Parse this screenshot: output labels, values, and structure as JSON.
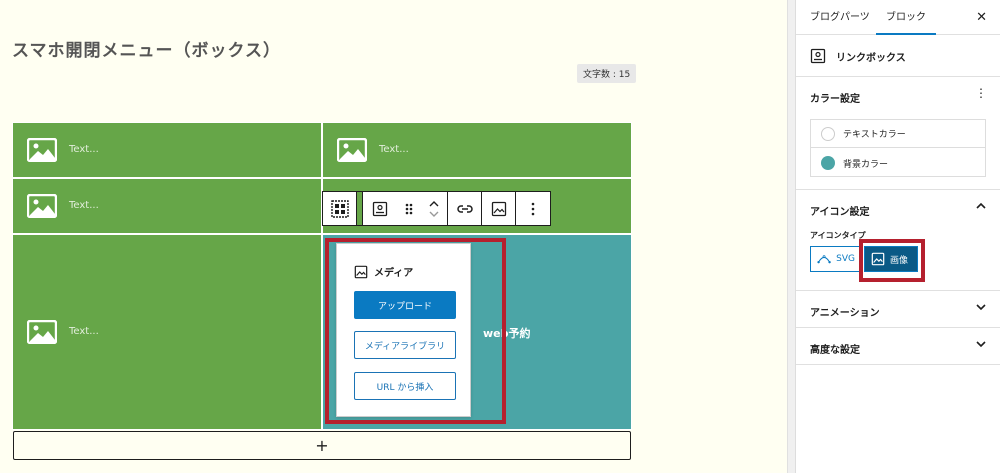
{
  "editor": {
    "title": "スマホ開閉メニュー（ボックス）",
    "char_count": "文字数 : 15",
    "cells": [
      {
        "text": "Text..."
      },
      {
        "text": "Text..."
      },
      {
        "text": "Text..."
      },
      {
        "text": "Text..."
      }
    ],
    "teal_cell_text": "web予約",
    "add_button": "+"
  },
  "toolbar": {
    "icons": [
      "grid-icon",
      "link-box-icon",
      "drag-handle-icon",
      "move-up-down-icon",
      "link-icon",
      "image-icon",
      "more-options-icon"
    ]
  },
  "media_popover": {
    "title": "メディア",
    "upload": "アップロード",
    "library": "メディアライブラリ",
    "insert_url": "URL から挿入"
  },
  "sidebar": {
    "tabs": [
      {
        "label": "ブログパーツ"
      },
      {
        "label": "ブロック"
      }
    ],
    "close": "✕",
    "block_name": "リンクボックス",
    "color_panel": {
      "title": "カラー設定",
      "text_color": "テキストカラー",
      "bg_color": "背景カラー",
      "bg_swatch": "#4ba5a6"
    },
    "icon_panel": {
      "title": "アイコン設定",
      "type_label": "アイコンタイプ",
      "svg_label": "SVG",
      "image_label": "画像"
    },
    "animation_panel": {
      "title": "アニメーション"
    },
    "advanced_panel": {
      "title": "高度な設定"
    }
  },
  "colors": {
    "green": "#66a648",
    "teal": "#4ba5a6",
    "accent": "#0a7ac2",
    "highlight": "#b5202e"
  }
}
